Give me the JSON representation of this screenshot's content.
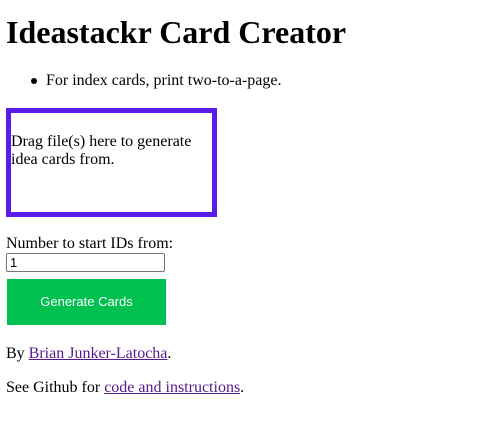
{
  "header": {
    "title": "Ideastackr Card Creator"
  },
  "tips": [
    "For index cards, print two-to-a-page."
  ],
  "dropzone": {
    "text": "Drag file(s) here to generate idea cards from.",
    "border_color": "#5b1be8"
  },
  "start_id": {
    "label": "Number to start IDs from:",
    "value": "1"
  },
  "generate_button": {
    "label": "Generate Cards",
    "color": "#00c04f"
  },
  "byline": {
    "prefix": "By ",
    "author_link": "Brian Junker-Latocha",
    "suffix": "."
  },
  "github": {
    "prefix": "See Github for ",
    "link": "code and instructions",
    "suffix": "."
  },
  "colors": {
    "link_visited": "#551a8b"
  }
}
